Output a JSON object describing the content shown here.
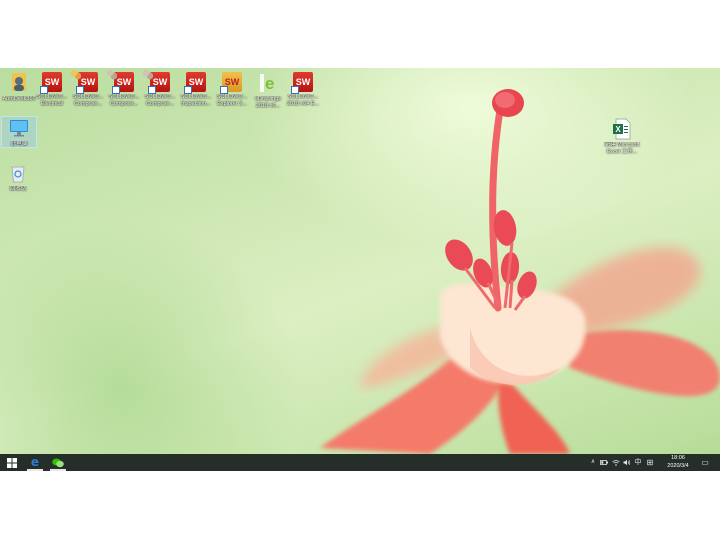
{
  "desktop": {
    "icons_top": [
      {
        "name": "autodesk-icon",
        "label": "AutoDesk360"
      },
      {
        "name": "solidworks-electrical-icon",
        "label": "SOLIDWO...\nElectrical"
      },
      {
        "name": "solidworks-composer-icon",
        "label": "SOLIDWO...\nCompose..."
      },
      {
        "name": "solidworks-composer-icon-2",
        "label": "SOLIDWO...\nCompose..."
      },
      {
        "name": "solidworks-composer-icon-3",
        "label": "SOLIDWO...\nCompose..."
      },
      {
        "name": "solidworks-inspection-icon",
        "label": "SOLIDWO...\nInspection..."
      },
      {
        "name": "solidworks-explorer-icon",
        "label": "SOLIDWO...\nExplorer 2..."
      },
      {
        "name": "edrawings-icon",
        "label": "eDrawings\n2018 x6..."
      },
      {
        "name": "solidworks-2018-icon",
        "label": "SOLIDWO...\n2018 x64 E..."
      }
    ],
    "this_pc_label": "此电脑",
    "recycle_bin_label": "回收站",
    "excel_file_label": "新建 Microsoft\nExcel 工作...",
    "sw_text": "SW",
    "e_text": "e"
  },
  "taskbar": {
    "start_glyph": "⊞",
    "edge_glyph": "e",
    "wechat_glyph": "●",
    "tray_chevron": "∧",
    "tray_ime": "中",
    "tray_keyboard": "⊞",
    "tray_notification": "▭",
    "time": "18:06",
    "date": "2020/3/4"
  },
  "colors": {
    "taskbar_bg": "#262e2a",
    "sw_red": "#d42a1e",
    "excel_green": "#1e7145",
    "edge_blue": "#2b7cd3",
    "wechat_green": "#2dc100"
  }
}
